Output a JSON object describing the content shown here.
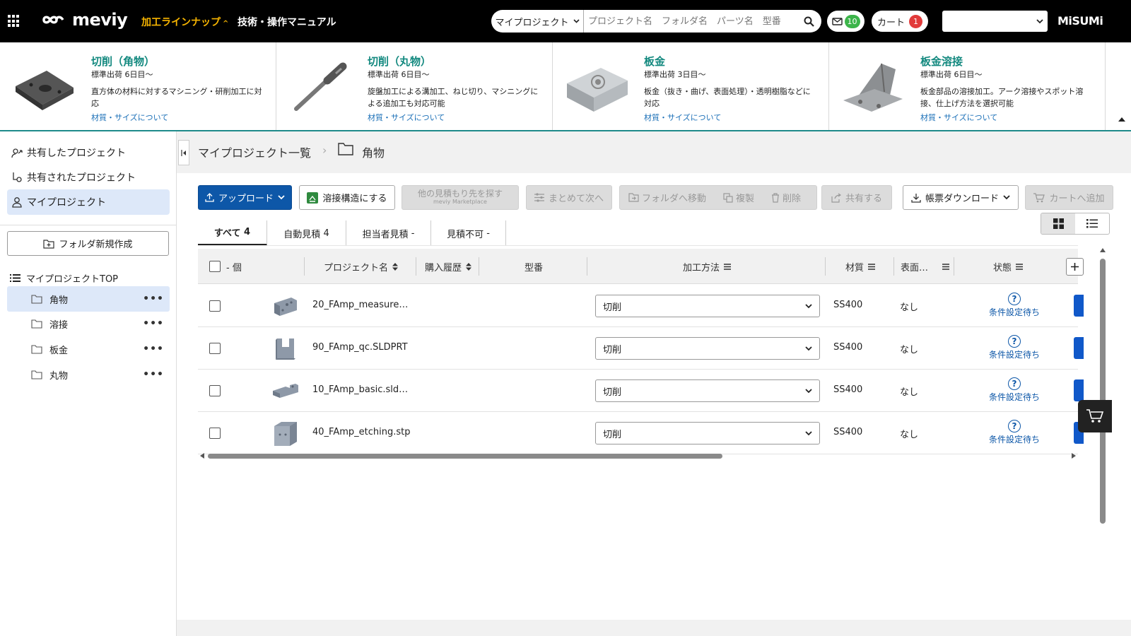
{
  "header": {
    "logo": "meviy",
    "nav_lineup": "加工ラインナップ",
    "nav_manual": "技術・操作マニュアル",
    "search_scope": "マイプロジェクト",
    "search_placeholder": "プロジェクト名　フォルダ名　パーツ名　型番",
    "mail_count": "10",
    "cart_label": "カート",
    "cart_count": "1",
    "account_value": "",
    "brand": "MiSUMi",
    "colors": {
      "accent": "#f7b500",
      "mail_badge": "#3cb44a",
      "cart_badge": "#e23b3b"
    }
  },
  "lineup": [
    {
      "title": "切削（角物）",
      "ship": "標準出荷 6日目～",
      "desc": "直方体の材料に対するマシニング・研削加工に対応",
      "link": "材質・サイズについて"
    },
    {
      "title": "切削（丸物）",
      "ship": "標準出荷 6日目～",
      "desc": "旋盤加工による溝加工、ねじ切り、マシニングによる追加工も対応可能",
      "link": "材質・サイズについて"
    },
    {
      "title": "板金",
      "ship": "標準出荷 3日目～",
      "desc": "板金（抜き・曲げ、表面処理）・透明樹脂などに対応",
      "link": "材質・サイズについて"
    },
    {
      "title": "板金溶接",
      "ship": "標準出荷 6日目～",
      "desc": "板金部品の溶接加工。アーク溶接やスポット溶接、仕上げ方法を選択可能",
      "link": "材質・サイズについて"
    }
  ],
  "sidebar": {
    "items": [
      {
        "label": "共有したプロジェクト"
      },
      {
        "label": "共有されたプロジェクト"
      },
      {
        "label": "マイプロジェクト"
      }
    ],
    "new_folder": "フォルダ新規作成",
    "tree_top": "マイプロジェクトTOP",
    "folders": [
      {
        "label": "角物"
      },
      {
        "label": "溶接"
      },
      {
        "label": "板金"
      },
      {
        "label": "丸物"
      }
    ]
  },
  "breadcrumb": {
    "root": "マイプロジェクト一覧",
    "current": "角物"
  },
  "toolbar": {
    "upload": "アップロード",
    "weld": "溶接構造にする",
    "other_quote": "他の見積もり先を探す",
    "marketplace": "meviy Marketplace",
    "batch_next": "まとめて次へ",
    "move_folder": "フォルダへ移動",
    "copy": "複製",
    "delete": "削除",
    "share": "共有する",
    "download": "帳票ダウンロード",
    "add_cart": "カートへ追加"
  },
  "tabs": [
    {
      "label": "すべて",
      "count": "4"
    },
    {
      "label": "自動見積",
      "count": "4"
    },
    {
      "label": "担当者見積",
      "count": "-"
    },
    {
      "label": "見積不可",
      "count": "-"
    }
  ],
  "table": {
    "headers": {
      "count": "- 個",
      "project_name": "プロジェクト名",
      "history": "購入履歴",
      "model_no": "型番",
      "method": "加工方法",
      "material": "材質",
      "surface": "表面…",
      "status": "状態"
    },
    "rows": [
      {
        "name": "20_FAmp_measurem…",
        "method": "切削",
        "material": "SS400",
        "surface": "なし",
        "status": "条件設定待ち"
      },
      {
        "name": "90_FAmp_qc.SLDPRT",
        "method": "切削",
        "material": "SS400",
        "surface": "なし",
        "status": "条件設定待ち"
      },
      {
        "name": "10_FAmp_basic.sldprt",
        "method": "切削",
        "material": "SS400",
        "surface": "なし",
        "status": "条件設定待ち"
      },
      {
        "name": "40_FAmp_etching.stp",
        "method": "切削",
        "material": "SS400",
        "surface": "なし",
        "status": "条件設定待ち"
      }
    ]
  }
}
